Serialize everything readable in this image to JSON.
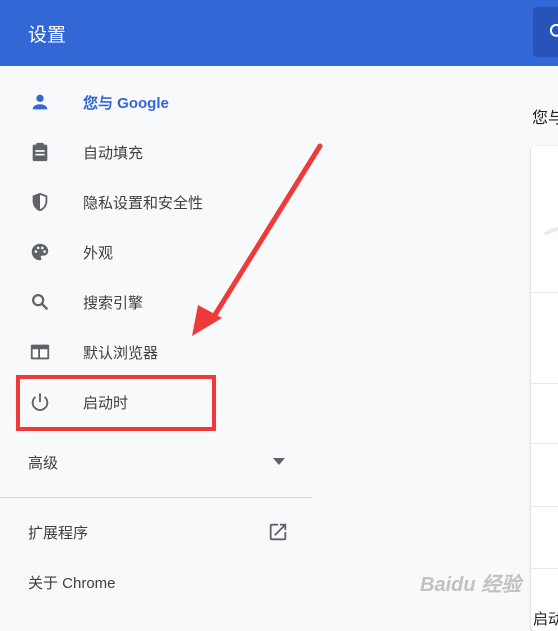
{
  "header": {
    "title": "设置"
  },
  "sidebar": {
    "items": [
      {
        "label": "您与 Google",
        "icon": "person-icon",
        "active": true
      },
      {
        "label": "自动填充",
        "icon": "clipboard-icon"
      },
      {
        "label": "隐私设置和安全性",
        "icon": "shield-icon"
      },
      {
        "label": "外观",
        "icon": "palette-icon"
      },
      {
        "label": "搜索引擎",
        "icon": "search-icon"
      },
      {
        "label": "默认浏览器",
        "icon": "browser-icon"
      },
      {
        "label": "启动时",
        "icon": "power-icon"
      }
    ],
    "advanced_label": "高级",
    "extensions_label": "扩展程序",
    "about_label": "关于 Chrome"
  },
  "main": {
    "section_title": "您与",
    "bottom_title": "启动"
  },
  "watermark": "Baidu 经验",
  "colors": {
    "accent": "#3367d6",
    "highlight": "#ee3a3a"
  }
}
